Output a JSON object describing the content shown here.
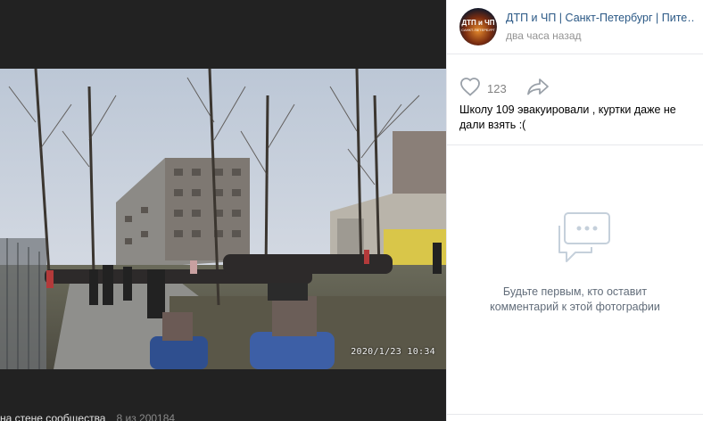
{
  "photo": {
    "timestamp": "2020/1/23  10:34"
  },
  "footer": {
    "location_link": "на стене сообщества",
    "counter": "8 из 200184"
  },
  "author": {
    "avatar_text": "ДТП и ЧП",
    "avatar_subtext": "САНКТ-ПЕТЕРБУРГ",
    "name": "ДТП и ЧП | Санкт-Петербург | Питер онлайн | СПб",
    "time": "два часа назад"
  },
  "actions": {
    "likes": "123",
    "like_icon": "heart-icon",
    "share_icon": "share-arrow-icon"
  },
  "caption": "Школу 109 эвакуировали , куртки даже не дали взять :(",
  "comments": {
    "empty_icon": "chat-bubble-icon",
    "empty_text": "Будьте первым, кто оставит комментарий к этой фотографии"
  },
  "colors": {
    "link": "#2a5885",
    "muted": "#939393",
    "dark_bg": "#222222"
  }
}
